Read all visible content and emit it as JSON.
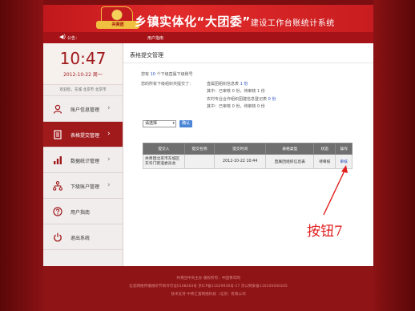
{
  "header": {
    "logo_text": "共青团",
    "title": "乡镇实体化“大团委”",
    "title_suffix": "建设工作台账统计系统"
  },
  "noticebar": {
    "notice_label": "公告：",
    "guide_link": "用户指南"
  },
  "sidebar": {
    "time": "10:47",
    "date": "2012-10-22  周一",
    "welcome": "欢迎您，东城 北京市 北京市",
    "items": [
      {
        "label": "账户信息管理",
        "icon": "user-icon",
        "active": false
      },
      {
        "label": "表格提交管理",
        "icon": "document-icon",
        "active": true
      },
      {
        "label": "数据统计管理",
        "icon": "bar-chart-icon",
        "active": false
      },
      {
        "label": "下级账户管理",
        "icon": "hierarchy-icon",
        "active": false
      },
      {
        "label": "用户指南",
        "icon": "help-icon",
        "active": false
      },
      {
        "label": "退出系统",
        "icon": "power-icon",
        "active": false
      }
    ]
  },
  "main": {
    "title": "表格提交管理",
    "stats": {
      "line1_pre": "您有",
      "line1_num": "10",
      "line1_post": "个下级直属下级账号",
      "line2": "您的所有下级组织共提交了：",
      "line2_item": "直属团组织信息表",
      "line2_count": "1 份",
      "line3": "其中：已审核 0 份，待审核 1 份",
      "line4_item": "农村专业合作组织团建信息登记表",
      "line4_count": "0 份",
      "line5": "其中：已审核 0 份，待审核 0 份"
    },
    "filter": {
      "select_value": "请选择",
      "query_label": "确认"
    },
    "table": {
      "headers": [
        "提交人",
        "提交名称",
        "提交时间",
        "表格类型",
        "状态",
        "操作"
      ],
      "rows": [
        {
          "submitter": "共青团北京市东城区东华门街道委员会",
          "name": "",
          "time": "2012-10-22 10:44",
          "type": "直属团组织信息表",
          "status": "待审核",
          "action": "审核"
        }
      ]
    }
  },
  "annotation": {
    "label": "按钮7",
    "color": "#e01e1e"
  },
  "footer": {
    "line1": "共青团中央主办  版权所有：中国青年网",
    "line2": "信息网络传播视听节目许可证0108264号  京ICP备11029930号-17  京公网安备110105000245",
    "line3": "技术支持 中青汇富网络科技（北京）有限公司"
  },
  "colors": {
    "brand_red": "#c0181c",
    "active_nav": "#a01a1c",
    "link_blue": "#2a4ec0",
    "button_blue": "#4b86d6"
  }
}
